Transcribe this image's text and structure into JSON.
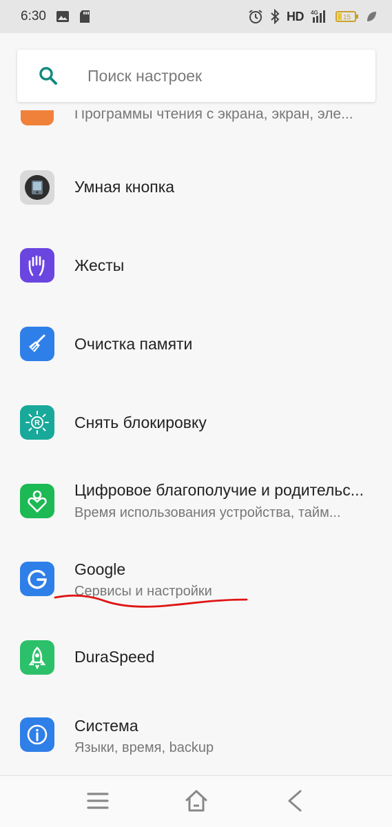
{
  "status_bar": {
    "time": "6:30",
    "network": "HD",
    "signal_type": "4G",
    "battery": "15"
  },
  "search": {
    "placeholder": "Поиск настроек"
  },
  "partial_item": {
    "subtitle": "Программы чтения с экрана, экран, эле..."
  },
  "items": [
    {
      "title": "Умная кнопка",
      "icon": "smart-button-icon",
      "color": "#3a3a3a"
    },
    {
      "title": "Жесты",
      "icon": "hand-gesture-icon",
      "color": "#6b45e0"
    },
    {
      "title": "Очистка памяти",
      "icon": "broom-icon",
      "color": "#2f7fe8"
    },
    {
      "title": "Снять блокировку",
      "icon": "unlock-icon",
      "color": "#19a99a"
    },
    {
      "title": "Цифровое благополучие и родительс...",
      "subtitle": "Время использования устройства, тайм...",
      "icon": "wellbeing-icon",
      "color": "#1db954"
    },
    {
      "title": "Google",
      "subtitle": "Сервисы и настройки",
      "icon": "google-icon",
      "color": "#2f7fe8"
    },
    {
      "title": "DuraSpeed",
      "icon": "rocket-icon",
      "color": "#2cc06a"
    },
    {
      "title": "Система",
      "subtitle": "Языки, время, backup",
      "icon": "info-icon",
      "color": "#2f7fe8"
    }
  ],
  "annotation_color": "#e01414"
}
